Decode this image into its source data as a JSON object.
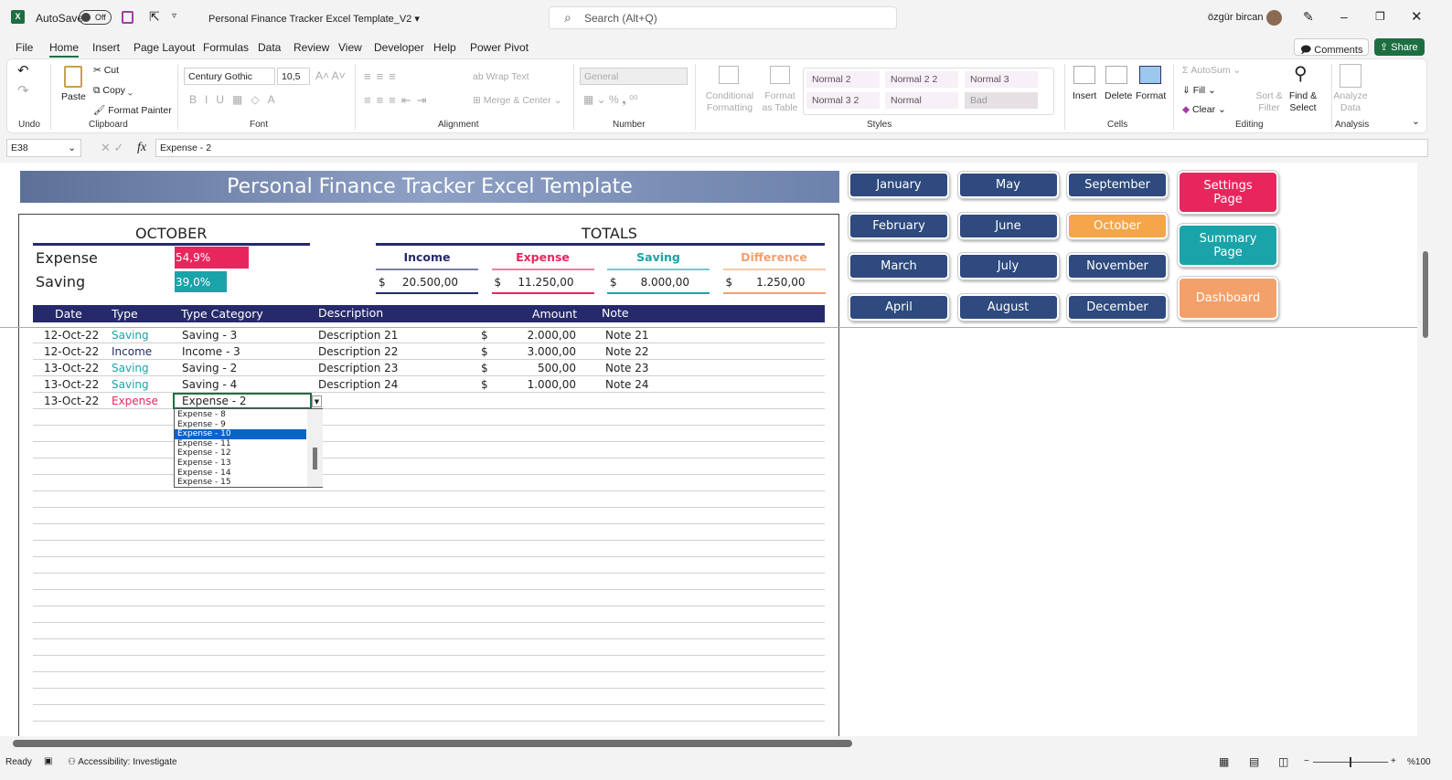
{
  "titlebar": {
    "autosave": "AutoSave",
    "toggle": "Off",
    "filename": "Personal Finance Tracker Excel Template_V2",
    "search": "Search (Alt+Q)",
    "user": "özgür bircan"
  },
  "menu": [
    "File",
    "Home",
    "Insert",
    "Page Layout",
    "Formulas",
    "Data",
    "Review",
    "View",
    "Developer",
    "Help",
    "Power Pivot"
  ],
  "actions": {
    "comments": "Comments",
    "share": "Share"
  },
  "ribbon": {
    "undo": "Undo",
    "paste": "Paste",
    "cut": "Cut",
    "copy": "Copy",
    "format_painter": "Format Painter",
    "clipboard": "Clipboard",
    "font_name": "Century Gothic",
    "font_size": "10,5",
    "font": "Font",
    "wrap_text": "Wrap Text",
    "merge_center": "Merge & Center",
    "alignment": "Alignment",
    "number_format": "General",
    "number": "Number",
    "conditional": "Conditional Formatting",
    "format_table": "Format as Table",
    "styles_list": [
      "Normal 2",
      "Normal 2 2",
      "Normal 3",
      "Normal 3 2",
      "Normal",
      "Bad"
    ],
    "styles": "Styles",
    "insert": "Insert",
    "delete": "Delete",
    "format": "Format",
    "cells": "Cells",
    "autosum": "AutoSum",
    "fill": "Fill",
    "clear": "Clear",
    "sort_filter": "Sort & Filter",
    "find_select": "Find & Select",
    "editing": "Editing",
    "analyze": "Analyze Data",
    "analysis": "Analysis"
  },
  "formula": {
    "cell_ref": "E38",
    "fx": "fx",
    "value": "Expense - 2"
  },
  "sheet": {
    "title": "Personal Finance Tracker Excel Template",
    "month": "OCTOBER",
    "expense_label": "Expense",
    "expense_pct": "54,9%",
    "expense_frac": 0.549,
    "saving_label": "Saving",
    "saving_pct": "39,0%",
    "saving_frac": 0.39,
    "totals_title": "TOTALS",
    "totals": [
      {
        "label": "Income",
        "value": "20.500,00",
        "color": "#262a6b"
      },
      {
        "label": "Expense",
        "value": "11.250,00",
        "color": "#e8265e"
      },
      {
        "label": "Saving",
        "value": "8.000,00",
        "color": "#1aa3a9"
      },
      {
        "label": "Difference",
        "value": "1.250,00",
        "color": "#f5a06e"
      }
    ],
    "currency": "$",
    "columns": [
      "Date",
      "Type",
      "Type Category",
      "Description",
      "Amount",
      "Note"
    ],
    "rows": [
      {
        "date": "12-Oct-22",
        "type": "Saving",
        "cat": "Saving - 3",
        "desc": "Description 21",
        "amount": "2.000,00",
        "note": "Note 21"
      },
      {
        "date": "12-Oct-22",
        "type": "Income",
        "cat": "Income - 3",
        "desc": "Description 22",
        "amount": "3.000,00",
        "note": "Note 22"
      },
      {
        "date": "13-Oct-22",
        "type": "Saving",
        "cat": "Saving - 2",
        "desc": "Description 23",
        "amount": "500,00",
        "note": "Note 23"
      },
      {
        "date": "13-Oct-22",
        "type": "Saving",
        "cat": "Saving - 4",
        "desc": "Description 24",
        "amount": "1.000,00",
        "note": "Note 24"
      },
      {
        "date": "13-Oct-22",
        "type": "Expense",
        "cat": "Expense - 2",
        "desc": "",
        "amount": "",
        "note": ""
      }
    ],
    "dropdown": [
      "Expense - 8",
      "Expense - 9",
      "Expense - 10",
      "Expense - 11",
      "Expense - 12",
      "Expense - 13",
      "Expense - 14",
      "Expense - 15"
    ],
    "dropdown_selected": "Expense - 10",
    "months": [
      "January",
      "February",
      "March",
      "April",
      "May",
      "June",
      "July",
      "August",
      "September",
      "October",
      "November",
      "December"
    ],
    "active_month": "October",
    "side_buttons": {
      "settings": "Settings Page",
      "summary": "Summary Page",
      "dashboard": "Dashboard"
    }
  },
  "status": {
    "ready": "Ready",
    "accessibility": "Accessibility: Investigate",
    "zoom": "%100"
  }
}
